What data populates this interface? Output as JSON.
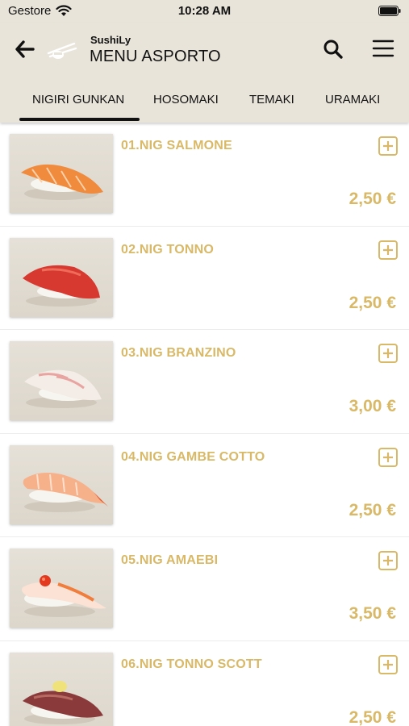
{
  "status": {
    "carrier": "Gestore",
    "time": "10:28 AM"
  },
  "header": {
    "brand": "SushiLy",
    "title": "MENU ASPORTO"
  },
  "tabs": [
    {
      "label": "NIGIRI GUNKAN",
      "selected": true
    },
    {
      "label": "HOSOMAKI",
      "selected": false
    },
    {
      "label": "TEMAKI",
      "selected": false
    },
    {
      "label": "URAMAKI",
      "selected": false
    }
  ],
  "colors": {
    "accent": "#d9b967",
    "header_bg": "#e8e4da",
    "text": "#111111"
  },
  "items": [
    {
      "name": "01.NIG SALMONE",
      "price": "2,50 €"
    },
    {
      "name": "02.NIG TONNO",
      "price": "2,50 €"
    },
    {
      "name": "03.NIG BRANZINO",
      "price": "3,00 €"
    },
    {
      "name": "04.NIG GAMBE COTTO",
      "price": "2,50 €"
    },
    {
      "name": "05.NIG AMAEBI",
      "price": "3,50 €"
    },
    {
      "name": "06.NIG TONNO SCOTT",
      "price": "2,50 €"
    }
  ]
}
